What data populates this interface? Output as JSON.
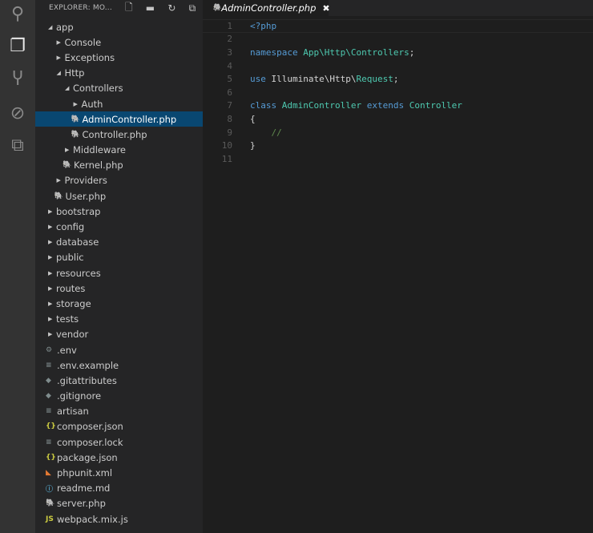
{
  "activity": [
    {
      "name": "search-icon",
      "glyph": "⚲"
    },
    {
      "name": "explorer-icon",
      "glyph": "❐"
    },
    {
      "name": "source-control-icon",
      "glyph": "Ⴤ"
    },
    {
      "name": "debug-icon",
      "glyph": "⊘"
    },
    {
      "name": "extensions-icon",
      "glyph": "⧉"
    }
  ],
  "sidebar": {
    "title": "EXPLORER: MO...",
    "actions": [
      {
        "name": "new-file-icon",
        "glyph": "🗋"
      },
      {
        "name": "new-folder-icon",
        "glyph": "▬"
      },
      {
        "name": "refresh-icon",
        "glyph": "↻"
      },
      {
        "name": "collapse-all-icon",
        "glyph": "⧉"
      }
    ],
    "tree": [
      {
        "label": "app",
        "depth": 0,
        "type": "folder",
        "open": true
      },
      {
        "label": "Console",
        "depth": 1,
        "type": "folder"
      },
      {
        "label": "Exceptions",
        "depth": 1,
        "type": "folder"
      },
      {
        "label": "Http",
        "depth": 1,
        "type": "folder",
        "open": true
      },
      {
        "label": "Controllers",
        "depth": 2,
        "type": "folder",
        "open": true
      },
      {
        "label": "Auth",
        "depth": 3,
        "type": "folder"
      },
      {
        "label": "AdminController.php",
        "depth": 3,
        "type": "php",
        "selected": true
      },
      {
        "label": "Controller.php",
        "depth": 3,
        "type": "php"
      },
      {
        "label": "Middleware",
        "depth": 2,
        "type": "folder"
      },
      {
        "label": "Kernel.php",
        "depth": 2,
        "type": "php"
      },
      {
        "label": "Providers",
        "depth": 1,
        "type": "folder"
      },
      {
        "label": "User.php",
        "depth": 1,
        "type": "php"
      },
      {
        "label": "bootstrap",
        "depth": 0,
        "type": "folder"
      },
      {
        "label": "config",
        "depth": 0,
        "type": "folder"
      },
      {
        "label": "database",
        "depth": 0,
        "type": "folder"
      },
      {
        "label": "public",
        "depth": 0,
        "type": "folder"
      },
      {
        "label": "resources",
        "depth": 0,
        "type": "folder"
      },
      {
        "label": "routes",
        "depth": 0,
        "type": "folder"
      },
      {
        "label": "storage",
        "depth": 0,
        "type": "folder"
      },
      {
        "label": "tests",
        "depth": 0,
        "type": "folder"
      },
      {
        "label": "vendor",
        "depth": 0,
        "type": "folder"
      },
      {
        "label": ".env",
        "depth": 0,
        "type": "gear"
      },
      {
        "label": ".env.example",
        "depth": 0,
        "type": "text"
      },
      {
        "label": ".gitattributes",
        "depth": 0,
        "type": "git"
      },
      {
        "label": ".gitignore",
        "depth": 0,
        "type": "git"
      },
      {
        "label": "artisan",
        "depth": 0,
        "type": "text"
      },
      {
        "label": "composer.json",
        "depth": 0,
        "type": "json"
      },
      {
        "label": "composer.lock",
        "depth": 0,
        "type": "text"
      },
      {
        "label": "package.json",
        "depth": 0,
        "type": "json"
      },
      {
        "label": "phpunit.xml",
        "depth": 0,
        "type": "rss"
      },
      {
        "label": "readme.md",
        "depth": 0,
        "type": "info"
      },
      {
        "label": "server.php",
        "depth": 0,
        "type": "php"
      },
      {
        "label": "webpack.mix.js",
        "depth": 0,
        "type": "js"
      }
    ]
  },
  "tab": {
    "label": "AdminController.php",
    "close": "✖"
  },
  "editor": {
    "lines": [
      [
        {
          "t": "<?php",
          "c": "kw"
        }
      ],
      [],
      [
        {
          "t": "namespace ",
          "c": "kw"
        },
        {
          "t": "App\\Http\\Controllers",
          "c": "ty"
        },
        {
          "t": ";",
          "c": "tx"
        }
      ],
      [],
      [
        {
          "t": "use ",
          "c": "kw"
        },
        {
          "t": "Illuminate\\Http\\",
          "c": "tx"
        },
        {
          "t": "Request",
          "c": "ty"
        },
        {
          "t": ";",
          "c": "tx"
        }
      ],
      [],
      [
        {
          "t": "class ",
          "c": "kw"
        },
        {
          "t": "AdminController ",
          "c": "ty"
        },
        {
          "t": "extends ",
          "c": "kw"
        },
        {
          "t": "Controller",
          "c": "ty"
        }
      ],
      [
        {
          "t": "{",
          "c": "tx"
        }
      ],
      [
        {
          "t": "    //",
          "c": "cm"
        }
      ],
      [
        {
          "t": "}",
          "c": "tx"
        }
      ],
      []
    ]
  },
  "colors": {
    "selection": "#094771",
    "php": "#a074c4",
    "json": "#cbcb41",
    "rss": "#e37933",
    "info": "#519aba",
    "js": "#cbcb41",
    "muted": "#7f8c8d"
  }
}
